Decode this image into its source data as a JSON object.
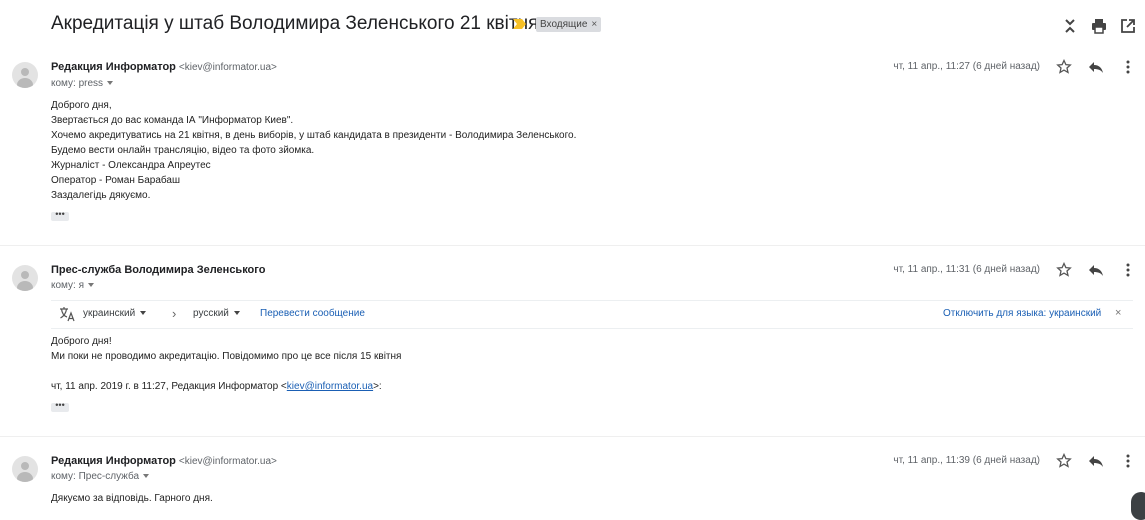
{
  "subject": "Акредитація у штаб Володимира Зеленського 21 квітня",
  "label_chip": {
    "label": "Входящие",
    "close": "×"
  },
  "toolbar": {
    "collapse_icon": "collapse-all-icon",
    "print_icon": "print-icon",
    "newwindow_icon": "open-in-new-window-icon"
  },
  "messages": [
    {
      "sender": "Редакция Информатор",
      "email": "<kiev@informator.ua>",
      "recipients": "кому: press",
      "date": "чт, 11 апр., 11:27 (6 дней назад)",
      "body": [
        "Доброго дня,",
        "Звертається до вас команда ІА \"Информатор Киев\".",
        "Хочемо акредитуватись на 21 квітня, в день виборів, у штаб кандидата в президенти - Володимира Зеленського.",
        "Будемо вести онлайн трансляцію, відео та фото зйомка.",
        "Журналіст - Олександра Апреутес",
        "Оператор - Роман Барабаш",
        "Заздалегідь дякуємо."
      ],
      "dots": "•••"
    },
    {
      "sender": "Прес-служба Володимира Зеленського",
      "email": "",
      "recipients": "кому: я",
      "date": "чт, 11 апр., 11:31 (6 дней назад)",
      "translate": {
        "from": "украинский",
        "arrow": "›",
        "to": "русский",
        "translate_link": "Перевести сообщение",
        "disable_link": "Отключить для языка: украинский",
        "close": "×"
      },
      "body": [
        "Доброго дня!",
        "Ми поки не проводимо акредитацію. Повідомимо про це все після 15 квітня"
      ],
      "quote_prefix": "чт, 11 апр. 2019 г. в 11:27, Редакция Информатор <",
      "quote_email": "kiev@informator.ua",
      "quote_suffix": ">:",
      "dots": "•••"
    },
    {
      "sender": "Редакция Информатор",
      "email": "<kiev@informator.ua>",
      "recipients": "кому: Прес-служба",
      "date": "чт, 11 апр., 11:39 (6 дней назад)",
      "body": [
        "Дякуємо за відповідь. Гарного дня."
      ]
    }
  ]
}
